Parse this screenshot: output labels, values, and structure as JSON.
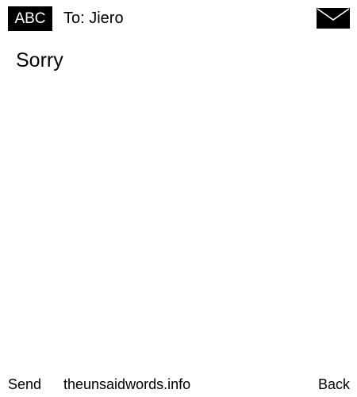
{
  "header": {
    "input_mode": "ABC",
    "recipient": "To: Jiero",
    "message_icon": "envelope-icon"
  },
  "message": {
    "text": "Sorry"
  },
  "softkeys": {
    "left": "Send",
    "center": "theunsaidwords.info",
    "right": "Back"
  },
  "colors": {
    "background": "#ffffff",
    "foreground": "#000000"
  }
}
